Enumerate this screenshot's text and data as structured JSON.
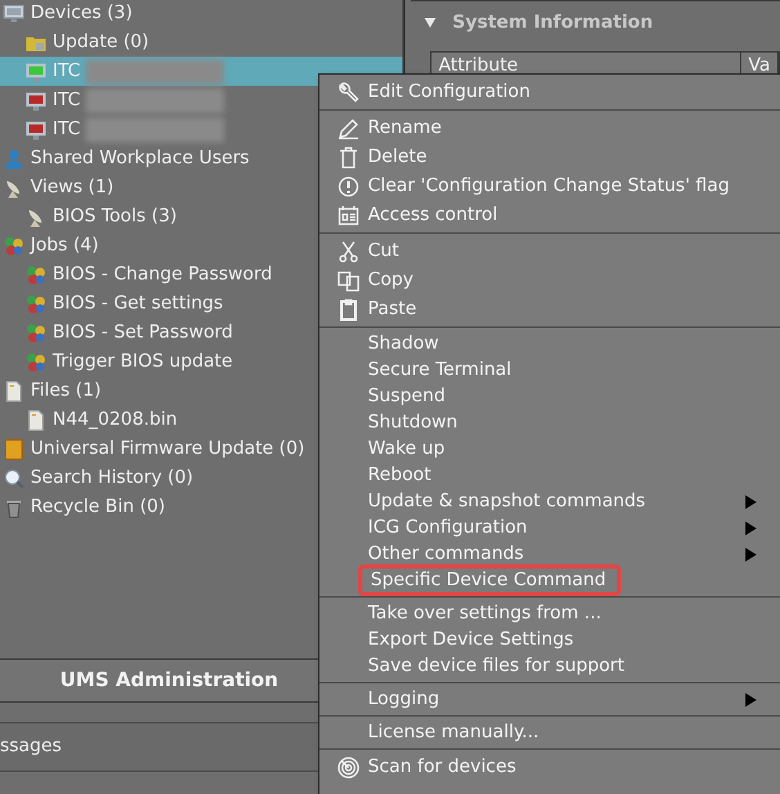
{
  "tree": [
    {
      "label": "Devices (3)",
      "kind": "devices",
      "selected": false,
      "children": [
        {
          "label": "Update (0)",
          "kind": "folder",
          "selected": false
        },
        {
          "label": "ITC",
          "kind": "device",
          "color": "#3cc83c",
          "blurred": true,
          "selected": true
        },
        {
          "label": "ITC",
          "kind": "device",
          "color": "#b82a2a",
          "blurred": true,
          "selected": false
        },
        {
          "label": "ITC",
          "kind": "device",
          "color": "#b82a2a",
          "blurred": true,
          "selected": false
        }
      ]
    },
    {
      "label": "Shared Workplace Users",
      "kind": "user",
      "selected": false
    },
    {
      "label": "Views (1)",
      "kind": "view",
      "selected": false,
      "children": [
        {
          "label": "BIOS Tools (3)",
          "kind": "view",
          "selected": false
        }
      ]
    },
    {
      "label": "Jobs (4)",
      "kind": "job",
      "selected": false,
      "children": [
        {
          "label": "BIOS - Change Password",
          "kind": "job",
          "selected": false
        },
        {
          "label": "BIOS - Get settings",
          "kind": "job",
          "selected": false
        },
        {
          "label": "BIOS - Set Password",
          "kind": "job",
          "selected": false
        },
        {
          "label": "Trigger BIOS update",
          "kind": "job",
          "selected": false
        }
      ]
    },
    {
      "label": "Files (1)",
      "kind": "file",
      "selected": false,
      "children": [
        {
          "label": "N44_0208.bin",
          "kind": "file",
          "selected": false
        }
      ]
    },
    {
      "label": "Universal Firmware Update (0)",
      "kind": "firmware",
      "selected": false
    },
    {
      "label": "Search History (0)",
      "kind": "search",
      "selected": false
    },
    {
      "label": "Recycle Bin (0)",
      "kind": "trash",
      "selected": false
    }
  ],
  "admin_bar": {
    "title": "UMS Administration"
  },
  "messages_bar": {
    "title": "ssages"
  },
  "system_panel": {
    "title": "System Information",
    "expanded": true,
    "columns": [
      "Attribute",
      "Va"
    ]
  },
  "context_menu": {
    "sections": [
      [
        {
          "label": "Edit Configuration",
          "kind": "wrench",
          "submenu": false,
          "highlighted": false
        }
      ],
      [
        {
          "label": "Rename",
          "kind": "pencil",
          "submenu": false,
          "highlighted": false
        },
        {
          "label": "Delete",
          "kind": "trash",
          "submenu": false,
          "highlighted": false
        },
        {
          "label": "Clear 'Configuration Change Status' flag",
          "kind": "alert",
          "submenu": false,
          "highlighted": false
        },
        {
          "label": "Access control",
          "kind": "badge",
          "submenu": false,
          "highlighted": false
        }
      ],
      [
        {
          "label": "Cut",
          "kind": "scissors",
          "submenu": false,
          "highlighted": false
        },
        {
          "label": "Copy",
          "kind": "copy",
          "submenu": false,
          "highlighted": false
        },
        {
          "label": "Paste",
          "kind": "clipboard",
          "submenu": false,
          "highlighted": false
        }
      ],
      [
        {
          "label": "Shadow",
          "submenu": false,
          "highlighted": false
        },
        {
          "label": "Secure Terminal",
          "submenu": false,
          "highlighted": false
        },
        {
          "label": "Suspend",
          "submenu": false,
          "highlighted": false
        },
        {
          "label": "Shutdown",
          "submenu": false,
          "highlighted": false
        },
        {
          "label": "Wake up",
          "submenu": false,
          "highlighted": false
        },
        {
          "label": "Reboot",
          "submenu": false,
          "highlighted": false
        },
        {
          "label": "Update & snapshot commands",
          "submenu": true,
          "highlighted": false
        },
        {
          "label": "ICG Configuration",
          "submenu": true,
          "highlighted": false
        },
        {
          "label": "Other commands",
          "submenu": true,
          "highlighted": false
        },
        {
          "label": "Specific Device Command",
          "submenu": false,
          "highlighted": true
        }
      ],
      [
        {
          "label": "Take over settings from ...",
          "submenu": false,
          "highlighted": false
        },
        {
          "label": "Export Device Settings",
          "submenu": false,
          "highlighted": false
        },
        {
          "label": "Save device files for support",
          "submenu": false,
          "highlighted": false
        }
      ],
      [
        {
          "label": "Logging",
          "submenu": true,
          "highlighted": false
        }
      ],
      [
        {
          "label": "License manually...",
          "submenu": false,
          "highlighted": false
        }
      ],
      [
        {
          "label": "Scan for devices",
          "kind": "radar",
          "submenu": false,
          "highlighted": false
        }
      ]
    ]
  }
}
